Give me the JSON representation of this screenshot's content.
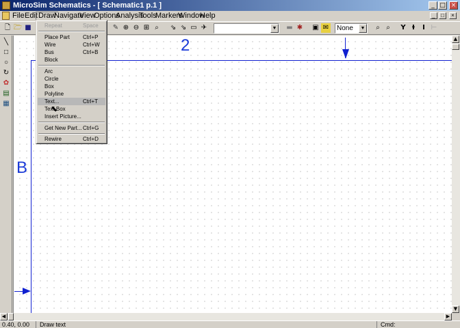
{
  "window": {
    "title": "MicroSim Schematics - [ Schematic1  p.1   ]",
    "controls": [
      "_",
      "□",
      "×"
    ]
  },
  "menubar": {
    "items": [
      "File",
      "Edit",
      "Draw",
      "Navigate",
      "View",
      "Options",
      "Analysis",
      "Tools",
      "Markers",
      "Window",
      "Help"
    ],
    "active": "Draw",
    "mdi_controls": [
      "_",
      "□",
      "×"
    ]
  },
  "toolbar": {
    "part_combo_value": "",
    "zoom_combo_value": "None",
    "icons": [
      "new-icon",
      "open-icon",
      "save-icon",
      "print-icon",
      "cut-icon",
      "copy-icon",
      "paste-icon",
      "undo-icon",
      "redo-icon",
      "draw-part-icon",
      "zoom-in-icon",
      "zoom-out-icon",
      "zoom-area-icon",
      "zoom-fit-icon",
      "edit-attributes-icon",
      "edit-symbol-icon",
      "setup-icon",
      "simulate-icon",
      "probe-icon",
      "voltage-marker-icon",
      "current-marker-icon",
      "text-marker-icon"
    ]
  },
  "palette": {
    "icons": [
      "wire-icon",
      "box-icon",
      "circle-icon",
      "arc-icon",
      "parts-icon",
      "library-icon",
      "graph-icon"
    ]
  },
  "canvas": {
    "zone_label_column": "2",
    "zone_label_row": "B"
  },
  "draw_menu": {
    "items": [
      {
        "label": "Repeat",
        "shortcut": "Space",
        "disabled": true
      },
      {
        "sep": true
      },
      {
        "label": "Place Part",
        "shortcut": "Ctrl+P"
      },
      {
        "label": "Wire",
        "shortcut": "Ctrl+W"
      },
      {
        "label": "Bus",
        "shortcut": "Ctrl+B"
      },
      {
        "label": "Block",
        "shortcut": ""
      },
      {
        "sep": true
      },
      {
        "label": "Arc",
        "shortcut": ""
      },
      {
        "label": "Circle",
        "shortcut": ""
      },
      {
        "label": "Box",
        "shortcut": ""
      },
      {
        "label": "Polyline",
        "shortcut": ""
      },
      {
        "label": "Text...",
        "shortcut": "Ctrl+T",
        "highlight": true
      },
      {
        "label": "Text Box",
        "shortcut": ""
      },
      {
        "label": "Insert Picture...",
        "shortcut": ""
      },
      {
        "sep": true
      },
      {
        "label": "Get New Part...",
        "shortcut": "Ctrl+G"
      },
      {
        "sep": true
      },
      {
        "label": "Rewire",
        "shortcut": "Ctrl+D"
      }
    ]
  },
  "statusbar": {
    "coords": "0.40, 0.00",
    "message": "Draw text",
    "cmd": "Cmd:"
  }
}
